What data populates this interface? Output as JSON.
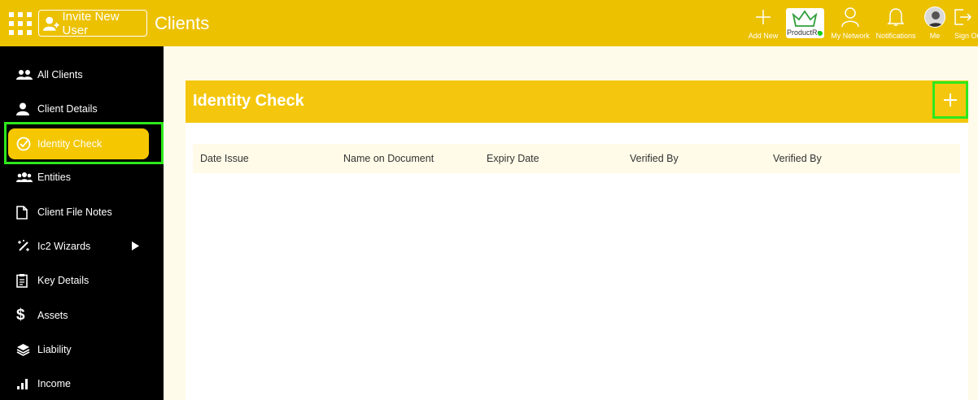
{
  "topbar": {
    "invite_label": "Invite New User",
    "page_title": "Clients",
    "actions": {
      "add_new": "Add New",
      "logo_text": "ProductRe",
      "my_network": "My Network",
      "notifications": "Notifications",
      "me": "Me",
      "sign_out": "Sign Out"
    }
  },
  "sidebar": {
    "items": [
      {
        "label": "All Clients",
        "icon": "users-icon"
      },
      {
        "label": "Client Details",
        "icon": "user-icon"
      },
      {
        "label": "Identity Check",
        "icon": "check-circle-icon",
        "active": true
      },
      {
        "label": "Entities",
        "icon": "group-icon"
      },
      {
        "label": "Client File Notes",
        "icon": "file-icon"
      },
      {
        "label": "Ic2 Wizards",
        "icon": "magic-wand-icon"
      },
      {
        "label": "Key Details",
        "icon": "clipboard-icon"
      },
      {
        "label": "Assets",
        "icon": "dollar-icon"
      },
      {
        "label": "Liability",
        "icon": "layers-icon"
      },
      {
        "label": "Income",
        "icon": "bar-chart-icon"
      }
    ]
  },
  "main": {
    "panel_title": "Identity Check",
    "table": {
      "columns": [
        "Date Issue",
        "Name on Document",
        "Expiry Date",
        "Verified By",
        "Verified By"
      ],
      "rows": []
    }
  },
  "colors": {
    "topbar": "#ecc100",
    "accent": "#f4c700",
    "highlight": "#2ee81c",
    "sidebar": "#000000"
  }
}
